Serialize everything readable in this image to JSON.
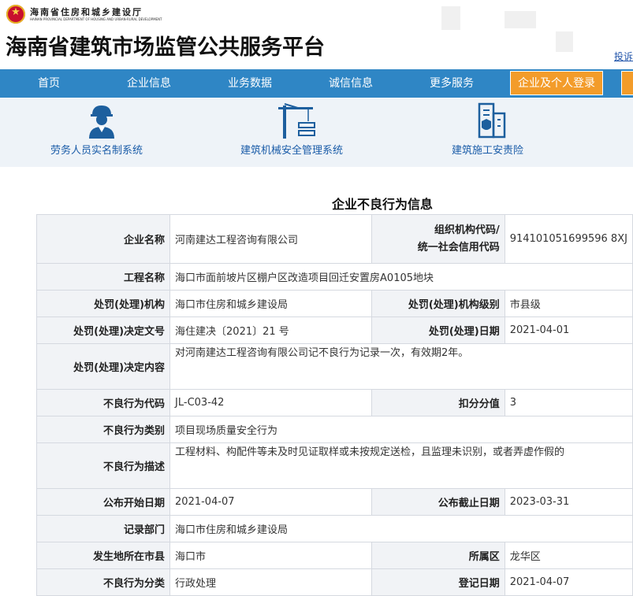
{
  "header": {
    "dept_name_cn": "海南省住房和城乡建设厅",
    "dept_name_en": "HAINAN PROVINCIAL DEPARTMENT OF HOUSING AND URBAN-RURAL DEVELOPMENT",
    "site_title": "海南省建筑市场监管公共服务平台",
    "complaint_link": "投诉"
  },
  "nav": {
    "items": [
      "首页",
      "企业信息",
      "业务数据",
      "诚信信息",
      "更多服务"
    ],
    "login": "企业及个人登录"
  },
  "quick_links": [
    {
      "label": "劳务人员实名制系统",
      "icon": "worker-icon"
    },
    {
      "label": "建筑机械安全管理系统",
      "icon": "tower-crane-icon"
    },
    {
      "label": "建筑施工安责险",
      "icon": "insurance-building-icon"
    }
  ],
  "record": {
    "title": "企业不良行为信息",
    "rows": {
      "r1": {
        "l1": "企业名称",
        "v1": "河南建达工程咨询有限公司",
        "l2a": "组织机构代码/",
        "l2b": "统一社会信用代码",
        "v2": "914101051699596 8XJ"
      },
      "r2": {
        "l1": "工程名称",
        "v1": "海口市面前坡片区棚户区改造项目回迁安置房A0105地块"
      },
      "r3": {
        "l1": "处罚(处理)机构",
        "v1": "海口市住房和城乡建设局",
        "l2": "处罚(处理)机构级别",
        "v2": "市县级"
      },
      "r4": {
        "l1": "处罚(处理)决定文号",
        "v1": "海住建决〔2021〕21 号",
        "l2": "处罚(处理)日期",
        "v2": "2021-04-01"
      },
      "r5": {
        "l1": "处罚(处理)决定内容",
        "v1": "对河南建达工程咨询有限公司记不良行为记录一次，有效期2年。"
      },
      "r6": {
        "l1": "不良行为代码",
        "v1": "JL-C03-42",
        "l2": "扣分分值",
        "v2": "3"
      },
      "r7": {
        "l1": "不良行为类别",
        "v1": "项目现场质量安全行为"
      },
      "r8": {
        "l1": "不良行为描述",
        "v1": "工程材料、构配件等未及时见证取样或未按规定送检，且监理未识别，或者弄虚作假的"
      },
      "r9": {
        "l1": "公布开始日期",
        "v1": "2021-04-07",
        "l2": "公布截止日期",
        "v2": "2023-03-31"
      },
      "r10": {
        "l1": "记录部门",
        "v1": "海口市住房和城乡建设局"
      },
      "r11": {
        "l1": "发生地所在市县",
        "v1": "海口市",
        "l2": "所属区",
        "v2": "龙华区"
      },
      "r12": {
        "l1": "不良行为分类",
        "v1": "行政处理",
        "l2": "登记日期",
        "v2": "2021-04-07"
      }
    }
  },
  "colors": {
    "nav_bg": "#2f86c5",
    "login_bg": "#f39c2a",
    "quick_bg": "#eef3f8",
    "link": "#1a5ca8",
    "label_bg": "#f1f3f6"
  }
}
